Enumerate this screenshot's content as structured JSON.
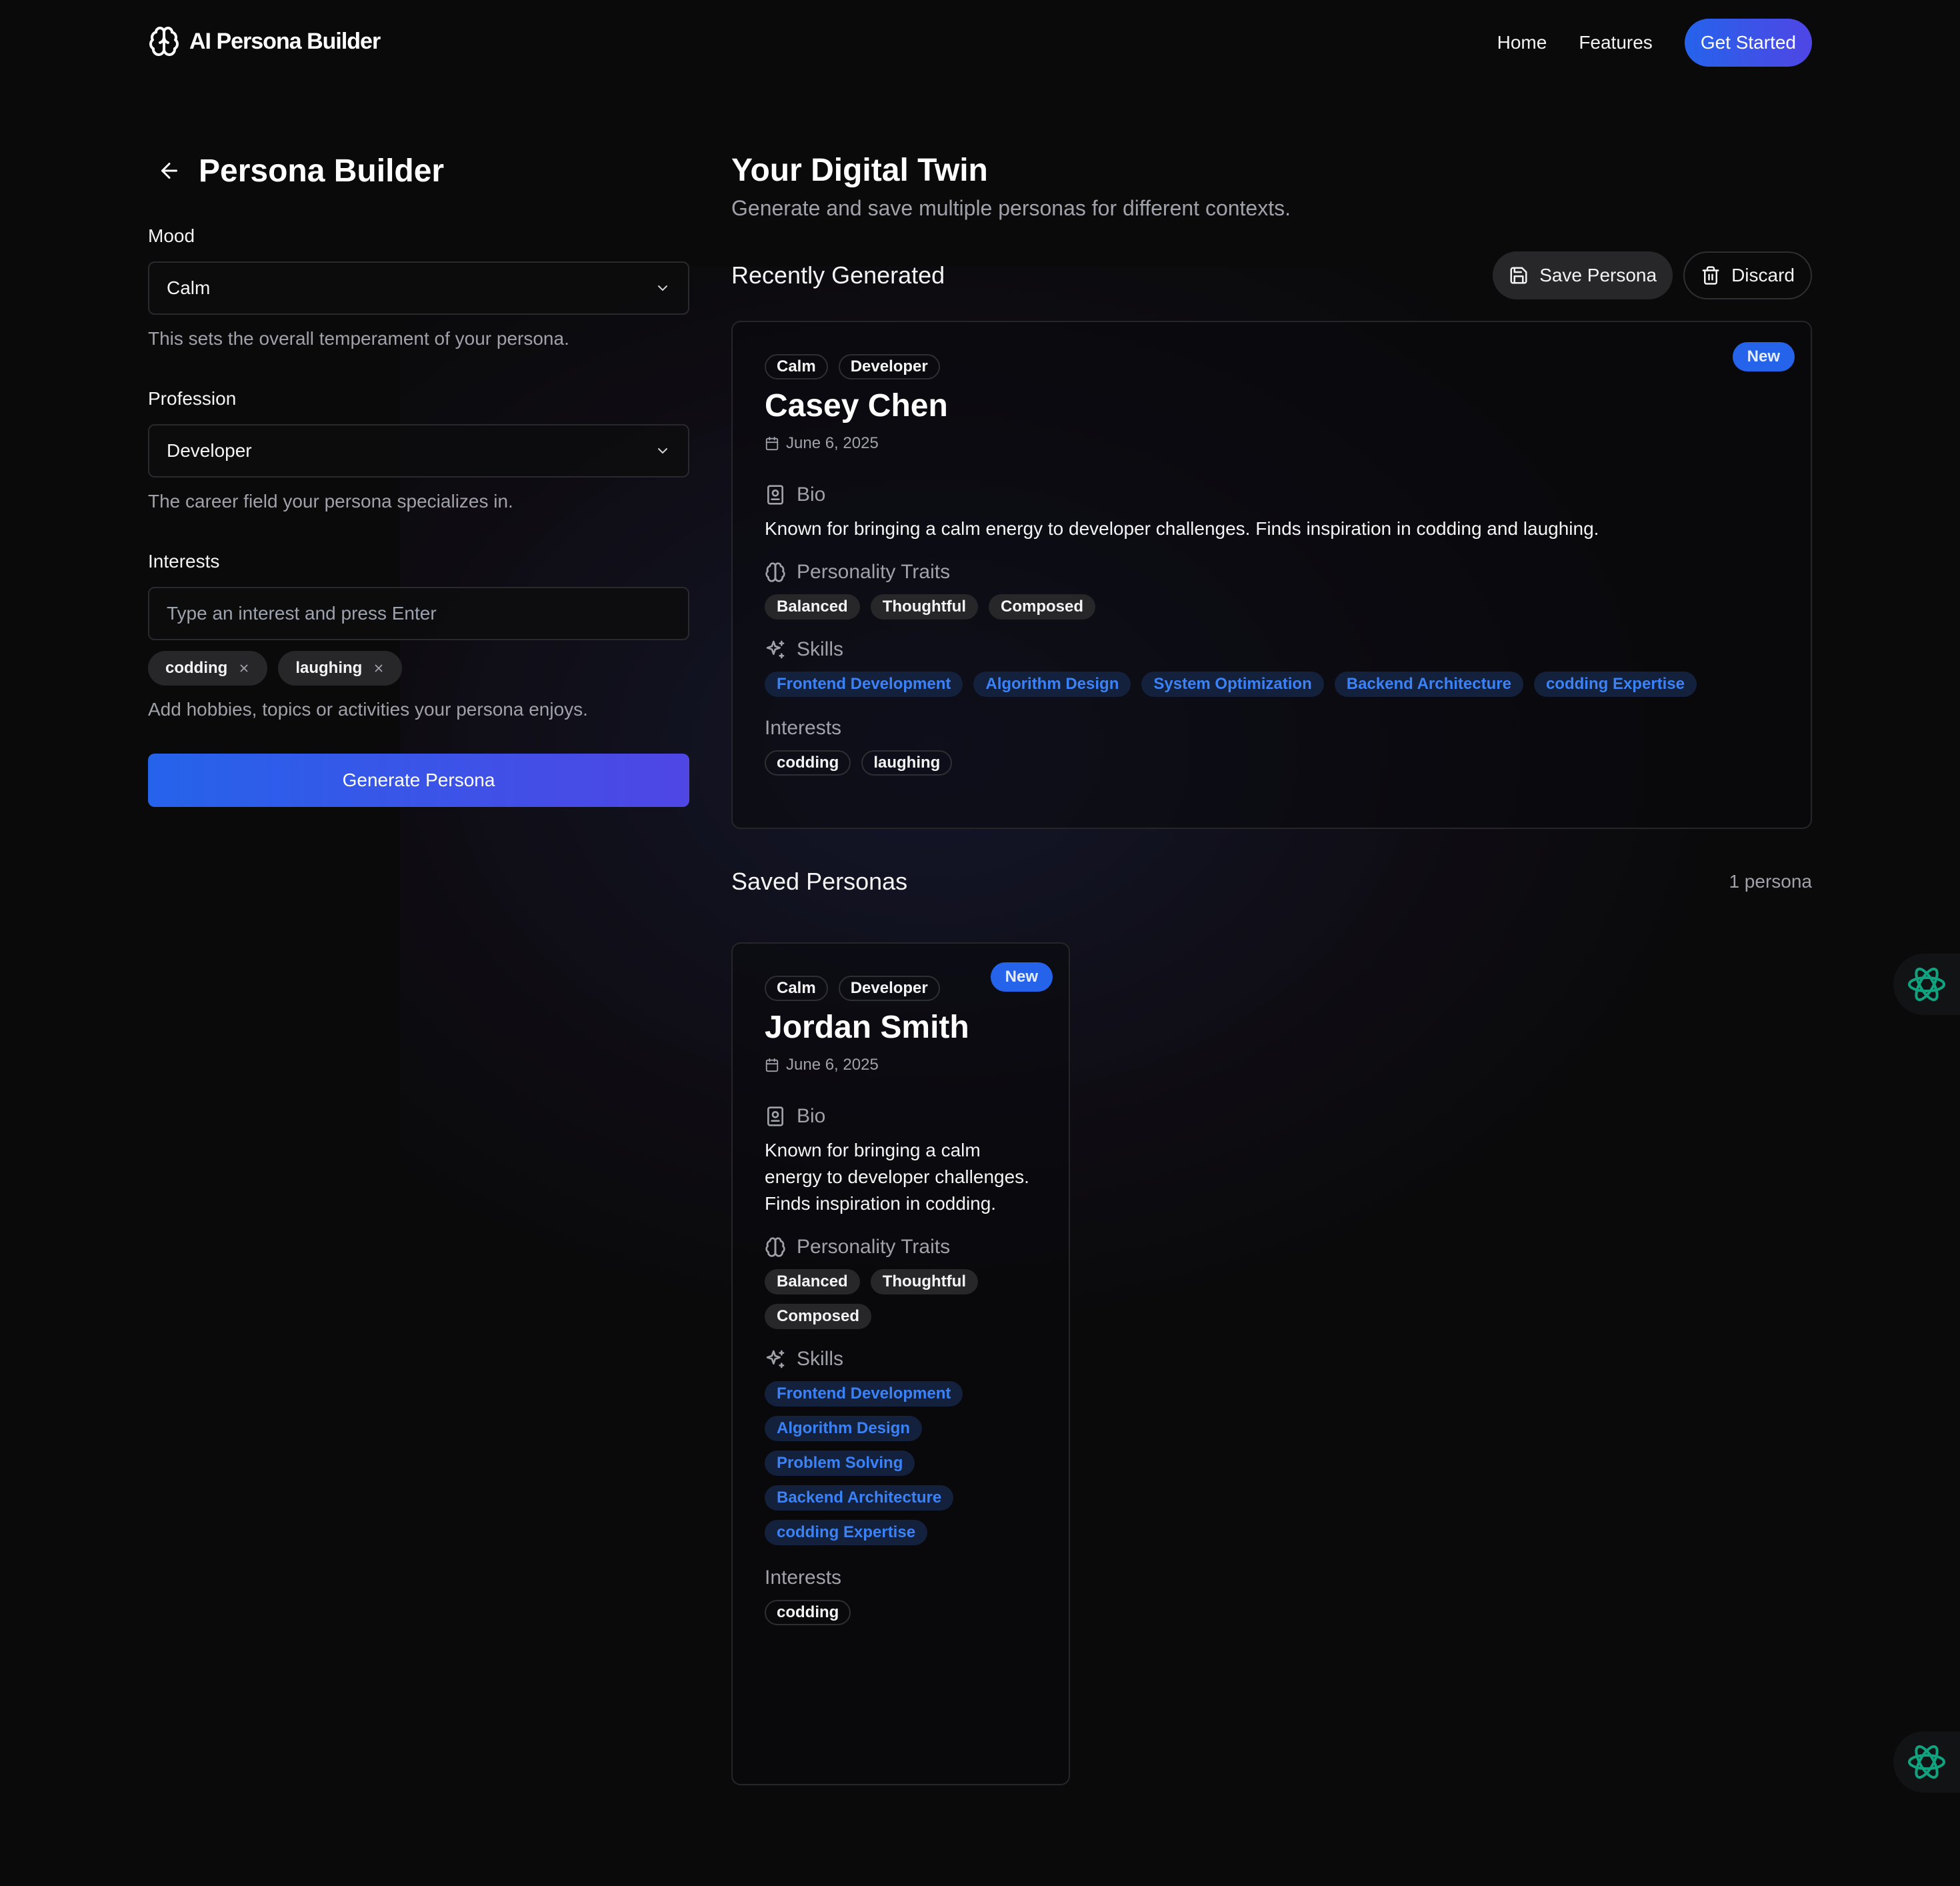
{
  "nav": {
    "brand": "AI Persona Builder",
    "links": [
      "Home",
      "Features"
    ],
    "cta": "Get Started"
  },
  "builder": {
    "title": "Persona Builder",
    "mood": {
      "label": "Mood",
      "value": "Calm",
      "help": "This sets the overall temperament of your persona."
    },
    "profession": {
      "label": "Profession",
      "value": "Developer",
      "help": "The career field your persona specializes in."
    },
    "interests": {
      "label": "Interests",
      "placeholder": "Type an interest and press Enter",
      "chips": [
        "codding",
        "laughing"
      ],
      "help": "Add hobbies, topics or activities your persona enjoys."
    },
    "generate_label": "Generate Persona"
  },
  "twin": {
    "title": "Your Digital Twin",
    "subtitle": "Generate and save multiple personas for different contexts."
  },
  "recent": {
    "heading": "Recently Generated",
    "save_label": "Save Persona",
    "discard_label": "Discard",
    "card": {
      "badge": "New",
      "tags": [
        "Calm",
        "Developer"
      ],
      "name": "Casey Chen",
      "date": "June 6, 2025",
      "bio_heading": "Bio",
      "bio": "Known for bringing a calm energy to developer challenges. Finds inspiration in codding and laughing.",
      "traits_heading": "Personality Traits",
      "traits": [
        "Balanced",
        "Thoughtful",
        "Composed"
      ],
      "skills_heading": "Skills",
      "skills": [
        "Frontend Development",
        "Algorithm Design",
        "System Optimization",
        "Backend Architecture",
        "codding Expertise"
      ],
      "interests_heading": "Interests",
      "interests": [
        "codding",
        "laughing"
      ]
    }
  },
  "saved": {
    "heading": "Saved Personas",
    "count": "1 persona",
    "card": {
      "badge": "New",
      "tags": [
        "Calm",
        "Developer"
      ],
      "name": "Jordan Smith",
      "date": "June 6, 2025",
      "bio_heading": "Bio",
      "bio": "Known for bringing a calm energy to developer challenges. Finds inspiration in codding.",
      "traits_heading": "Personality Traits",
      "traits": [
        "Balanced",
        "Thoughtful",
        "Composed"
      ],
      "skills_heading": "Skills",
      "skills": [
        "Frontend Development",
        "Algorithm Design",
        "Problem Solving",
        "Backend Architecture",
        "codding Expertise"
      ],
      "interests_heading": "Interests",
      "interests": [
        "codding"
      ]
    }
  },
  "icons": {
    "brand": "brain-icon",
    "back": "arrow-left-icon",
    "select": "chevron-down-icon",
    "chip_remove": "close-icon",
    "save": "save-icon",
    "discard": "trash-icon",
    "date": "calendar-icon",
    "bio": "contact-icon",
    "traits": "brain-icon",
    "skills": "sparkles-icon",
    "floating": "openai-icon"
  },
  "colors": {
    "background": "#0a0a0b",
    "accent_blue": "#2563eb",
    "accent_indigo": "#4f46e5",
    "skill_text": "#3b82f6",
    "floating_icon": "#10a37f"
  }
}
